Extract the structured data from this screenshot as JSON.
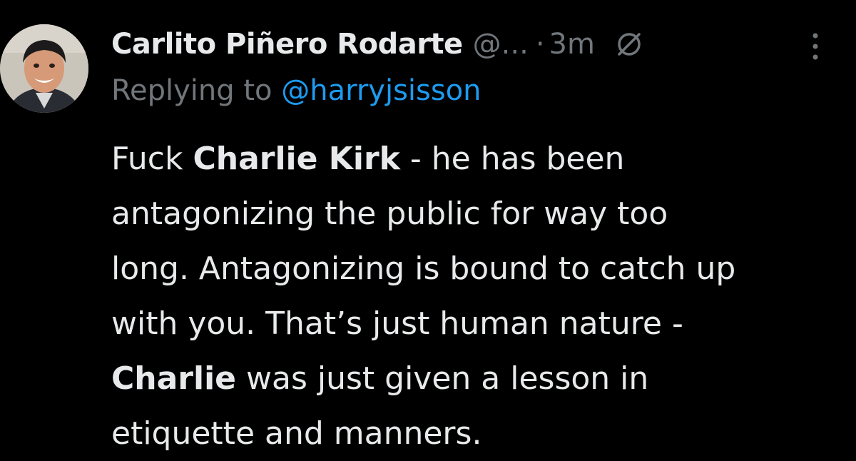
{
  "tweet": {
    "author_name": "Carlito Piñero Rodarte",
    "author_handle": "@...",
    "separator": "·",
    "time": "3m",
    "mute_icon": "mute-icon",
    "more_icon": "more-options-icon",
    "reply_prefix": "Replying to",
    "reply_to": "@harryjsisson",
    "body_lines": [
      {
        "parts": [
          {
            "text": "Fuck ",
            "bold": false
          },
          {
            "text": "Charlie Kirk",
            "bold": true
          },
          {
            "text": " - he has been",
            "bold": false
          }
        ]
      },
      {
        "parts": [
          {
            "text": "antagonizing the public for way too",
            "bold": false
          }
        ]
      },
      {
        "parts": [
          {
            "text": "long. Antagonizing is bound to catch up",
            "bold": false
          }
        ]
      },
      {
        "parts": [
          {
            "text": "with you. That’s just human nature -",
            "bold": false
          }
        ]
      },
      {
        "parts": [
          {
            "text": "Charlie",
            "bold": true
          },
          {
            "text": " was just given a lesson in",
            "bold": false
          }
        ]
      },
      {
        "parts": [
          {
            "text": "etiquette and manners.",
            "bold": false
          }
        ]
      }
    ],
    "colors": {
      "background": "#000000",
      "text": "#e7e9ea",
      "secondary": "#71767b",
      "link": "#1d9bf0"
    }
  }
}
